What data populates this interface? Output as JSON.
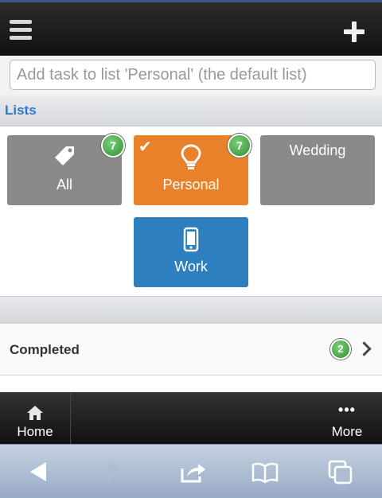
{
  "header": {
    "menu_icon": "hamburger-menu-icon",
    "add_icon": "plus-icon"
  },
  "task_input": {
    "placeholder": "Add task to list 'Personal' (the default list)",
    "value": ""
  },
  "lists_section": {
    "title": "Lists",
    "color": "#2b79c9"
  },
  "lists": [
    {
      "label": "All",
      "icon": "tag-icon",
      "count": "7",
      "color": "#8a8a8a"
    },
    {
      "label": "Personal",
      "icon": "lightbulb-icon",
      "count": "7",
      "selected": true,
      "color": "#e9812a"
    },
    {
      "label": "Wedding",
      "icon": "",
      "color": "#8a8a8a"
    },
    {
      "label": "Work",
      "icon": "smartphone-icon",
      "color": "#2d7fc0"
    }
  ],
  "completed": {
    "label": "Completed",
    "count": "2"
  },
  "bottom_nav": {
    "home_label": "Home",
    "more_label": "More",
    "more_dots": "•••"
  },
  "browser_toolbar": {
    "icons": [
      "back-arrow-icon",
      "forward-arrow-icon",
      "share-icon",
      "bookmarks-icon",
      "tabs-icon"
    ]
  }
}
